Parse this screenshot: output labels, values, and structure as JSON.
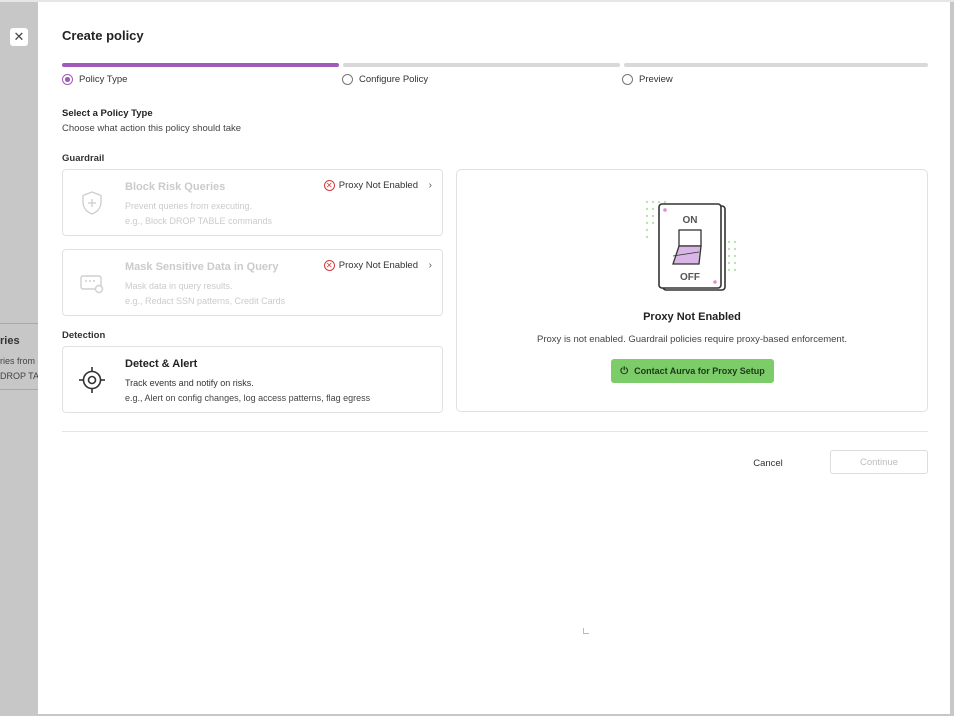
{
  "backdrop": {
    "title_fragment": "ries",
    "line1_fragment": "ries from e",
    "line2_fragment": "DROP TABL"
  },
  "close": {
    "glyph": "✕"
  },
  "modal": {
    "title": "Create policy",
    "steps": [
      {
        "label": "Policy Type",
        "active": true
      },
      {
        "label": "Configure Policy",
        "active": false
      },
      {
        "label": "Preview",
        "active": false
      }
    ],
    "heading": "Select a Policy Type",
    "subheading": "Choose what action this policy should take",
    "groups": {
      "guardrail": "Guardrail",
      "detection": "Detection"
    },
    "cards": [
      {
        "title": "Block Risk Queries",
        "description": "Prevent queries from executing.",
        "example": "e.g., Block DROP TABLE commands",
        "badge": "Proxy Not Enabled",
        "disabled": true,
        "icon": "shield-plus-icon"
      },
      {
        "title": "Mask Sensitive Data in Query",
        "description": "Mask data in query results.",
        "example": "e.g., Redact SSN patterns, Credit Cards",
        "badge": "Proxy Not Enabled",
        "disabled": true,
        "icon": "mask-data-icon"
      },
      {
        "title": "Detect & Alert",
        "description": "Track events and notify on risks.",
        "example": "e.g., Alert on config changes, log access patterns, flag egress",
        "disabled": false,
        "icon": "crosshair-icon"
      }
    ],
    "panel": {
      "switch_on": "ON",
      "switch_off": "OFF",
      "title": "Proxy Not Enabled",
      "text": "Proxy is not enabled. Guardrail policies require proxy-based enforcement.",
      "button": "Contact Aurva for Proxy Setup"
    },
    "footer": {
      "cancel": "Cancel",
      "continue": "Continue"
    }
  },
  "colors": {
    "accent": "#a25aba",
    "success_button": "#7ccc6a",
    "error": "#d23a3a"
  }
}
